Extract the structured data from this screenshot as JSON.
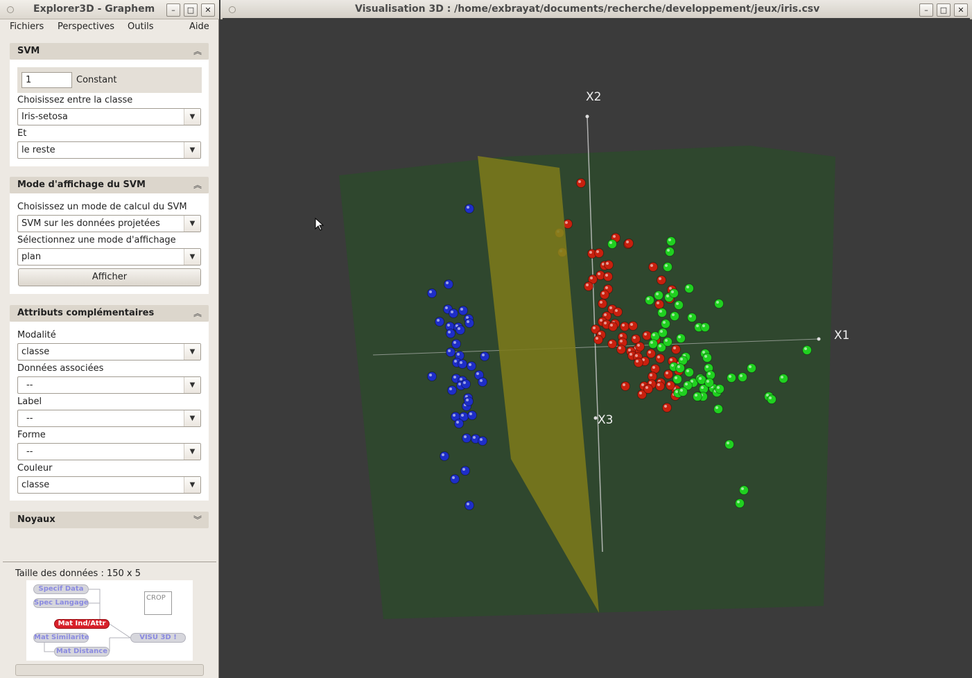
{
  "left_window": {
    "title": "Explorer3D - Graphem",
    "menu": [
      "Fichiers",
      "Perspectives",
      "Outils",
      "Aide"
    ],
    "svm_panel": {
      "header": "SVM",
      "constant_value": "1",
      "constant_label": "Constant",
      "class_label": "Choisissez entre la classe",
      "class_value": "Iris-setosa",
      "and_label": "Et",
      "and_value": "le reste"
    },
    "mode_panel": {
      "header": "Mode d'affichage du SVM",
      "calc_label": "Choisissez un mode de calcul du SVM",
      "calc_value": "SVM sur les données projetées",
      "display_label": "Sélectionnez une mode d'affichage",
      "display_value": "plan",
      "show_button": "Afficher"
    },
    "attr_panel": {
      "header": "Attributs complémentaires",
      "fields": [
        {
          "label": "Modalité",
          "value": "classe"
        },
        {
          "label": "Données associées",
          "value": "--"
        },
        {
          "label": "Label",
          "value": "--"
        },
        {
          "label": "Forme",
          "value": "--"
        },
        {
          "label": "Couleur",
          "value": "classe"
        }
      ]
    },
    "kernel_panel": {
      "header": "Noyaux"
    },
    "data_size": "Taille des données : 150 x 5",
    "workflow": {
      "nodes": [
        "Specif Data",
        "Spec Langage",
        "Mat Ind/Attr",
        "Mat Similarite",
        "Mat Distance",
        "VISU 3D !"
      ],
      "crop": "CROP"
    },
    "icons": {
      "expand_panel": "chevron-up-icon",
      "collapsed_panel": "chevron-down-icon",
      "dropdown": "dropdown-arrow-icon"
    }
  },
  "right_window": {
    "title": "Visualisation 3D : /home/exbrayat/documents/recherche/developpement/jeux/iris.csv",
    "axes": {
      "x1": "X1",
      "x2": "X2",
      "x3": "X3"
    },
    "colors": {
      "background": "#3b3b3b",
      "back_plane": "#2f472e",
      "svm_plane": "#7c7a1b",
      "setosa": "#1e2ec8",
      "versicolor": "#c8200e",
      "virginica": "#20d020",
      "misclassified": "#e07a10"
    }
  }
}
